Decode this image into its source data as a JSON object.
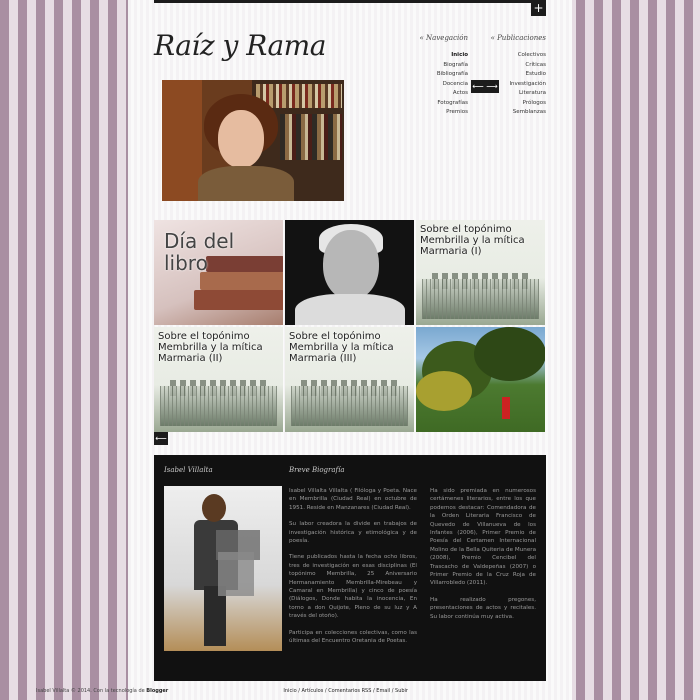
{
  "header": {
    "site_title": "Raíz y Rama",
    "plus_label": "+"
  },
  "nav": {
    "navigation": {
      "heading": "« Navegación",
      "items": [
        "Inicio",
        "Biografía",
        "Bibliografía",
        "Docencia",
        "Actos",
        "Fotografías",
        "Premios"
      ]
    },
    "publications": {
      "heading": "« Publicaciones",
      "items": [
        "Colectivos",
        "Críticas",
        "Estudio",
        "Investigación",
        "Literatura",
        "Prólogos",
        "Semblanzas"
      ]
    }
  },
  "hero": {
    "prev": "⟵",
    "next": "⟶"
  },
  "grid": {
    "tiles": [
      {
        "title": "Día del libro"
      },
      {
        "title": ""
      },
      {
        "title": "Sobre el topónimo Membrilla y la mítica Marmaria (I)"
      },
      {
        "title": "Sobre el topónimo Membrilla y la mítica Marmaria (II)"
      },
      {
        "title": "Sobre el topónimo Membrilla y la mítica Marmaria (III)"
      },
      {
        "title": ""
      }
    ],
    "prev": "⟵"
  },
  "about": {
    "name_heading": "Isabel Villalta",
    "bio_heading": "Breve Biografía",
    "col1": [
      "Isabel Villalta Villalta ( Filóloga y Poeta. Nace en Membrilla (Ciudad Real) en octubre de 1951. Reside en Manzanares (Ciudad Real).",
      "Su labor creadora la divide en trabajos de investigación histórica y etimológica y de poesía.",
      "Tiene publicados hasta la fecha ocho libros, tres de investigación en esas disciplinas (El topónimo Membrilla, 25 Aniversario Hermanamiento Membrilla-Mirebeau y Camaral en Membrilla) y cinco de poesía (Diálogos, Donde habita la inocencia, En torno a don Quijote, Pleno de su luz y A través del otoño).",
      "Participa en colecciones colectivas, como las últimas del Encuentro Oretania de Poetas."
    ],
    "col2": [
      "Ha sido premiada en numerosos certámenes literarios, entre los que podemos destacar: Comendadora de la Orden Literaria Francisco de Quevedo de Villanueva de los Infantes (2006), Primer Premio de Poesía del Certamen Internacional Molino de la Bella Quiteria de Munera (2008), Premio Cencibel del Trascacho de Valdepeñas (2007) o Primer Premio de la Cruz Roja de Villarrobledo (2011).",
      "Ha realizado pregones, presentaciones de actos y recitales. Su labor continúa muy activa."
    ]
  },
  "footer": {
    "copyright": "Isabel Villalta © 2014. Con la tecnología de",
    "brand": "Blogger",
    "links": [
      "Inicio",
      "Artículos",
      "Comentarios RSS",
      "Email",
      "Subir"
    ],
    "sep": " / "
  }
}
